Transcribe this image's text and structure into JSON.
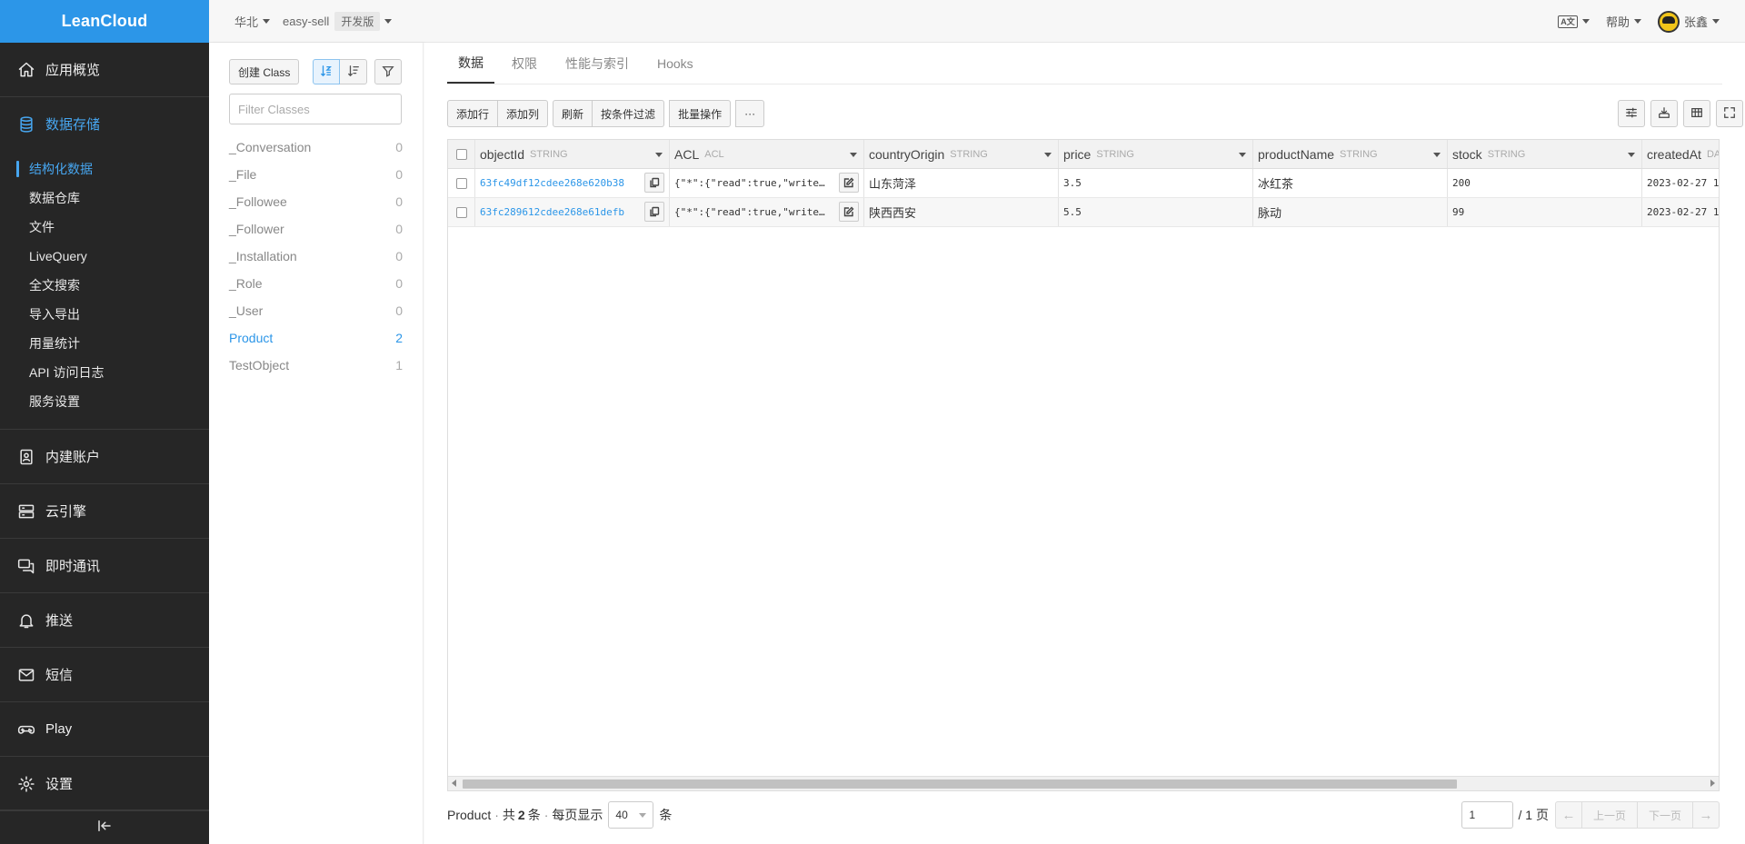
{
  "brand": "LeanCloud",
  "topbar": {
    "region": "华北",
    "app_name": "easy-sell",
    "env": "开发版",
    "lang_icon_text": "A文",
    "help": "帮助",
    "user": "张鑫"
  },
  "sidebar": {
    "overview": "应用概览",
    "storage": "数据存储",
    "storage_sub": [
      "结构化数据",
      "数据仓库",
      "文件",
      "LiveQuery",
      "全文搜索",
      "导入导出",
      "用量统计",
      "API 访问日志",
      "服务设置"
    ],
    "accounts": "内建账户",
    "engine": "云引擎",
    "im": "即时通讯",
    "push": "推送",
    "sms": "短信",
    "play": "Play",
    "settings": "设置"
  },
  "class_panel": {
    "create_btn": "创建 Class",
    "filter_placeholder": "Filter Classes",
    "classes": [
      {
        "name": "_Conversation",
        "count": "0"
      },
      {
        "name": "_File",
        "count": "0"
      },
      {
        "name": "_Followee",
        "count": "0"
      },
      {
        "name": "_Follower",
        "count": "0"
      },
      {
        "name": "_Installation",
        "count": "0"
      },
      {
        "name": "_Role",
        "count": "0"
      },
      {
        "name": "_User",
        "count": "0"
      },
      {
        "name": "Product",
        "count": "2"
      },
      {
        "name": "TestObject",
        "count": "1"
      }
    ],
    "selected": "Product"
  },
  "tabs": [
    "数据",
    "权限",
    "性能与索引",
    "Hooks"
  ],
  "toolbar": {
    "add_row": "添加行",
    "add_col": "添加列",
    "refresh": "刷新",
    "filter": "按条件过滤",
    "batch": "批量操作",
    "more": "···"
  },
  "table": {
    "columns": [
      {
        "name": "objectId",
        "type": "STRING"
      },
      {
        "name": "ACL",
        "type": "ACL"
      },
      {
        "name": "countryOrigin",
        "type": "STRING"
      },
      {
        "name": "price",
        "type": "STRING"
      },
      {
        "name": "productName",
        "type": "STRING"
      },
      {
        "name": "stock",
        "type": "STRING"
      },
      {
        "name": "createdAt",
        "type": "DA"
      }
    ],
    "rows": [
      {
        "objectId": "63fc49df12cdee268e620b38",
        "ACL": "{\"*\":{\"read\":true,\"write\"…",
        "countryOrigin": "山东菏泽",
        "price": "3.5",
        "productName": "冰红茶",
        "stock": "200",
        "createdAt": "2023-02-27 1"
      },
      {
        "objectId": "63fc289612cdee268e61defb",
        "ACL": "{\"*\":{\"read\":true,\"write\"…",
        "countryOrigin": "陕西西安",
        "price": "5.5",
        "productName": "脉动",
        "stock": "99",
        "createdAt": "2023-02-27 1"
      }
    ]
  },
  "footer": {
    "class_name": "Product",
    "sep": "·",
    "total_prefix": "共",
    "total": "2",
    "total_suffix": "条",
    "per_page_label": "每页显示",
    "per_page": "40",
    "per_page_suffix": "条",
    "page": "1",
    "page_total": "/ 1 页",
    "prev": "上一页",
    "next": "下一页"
  }
}
